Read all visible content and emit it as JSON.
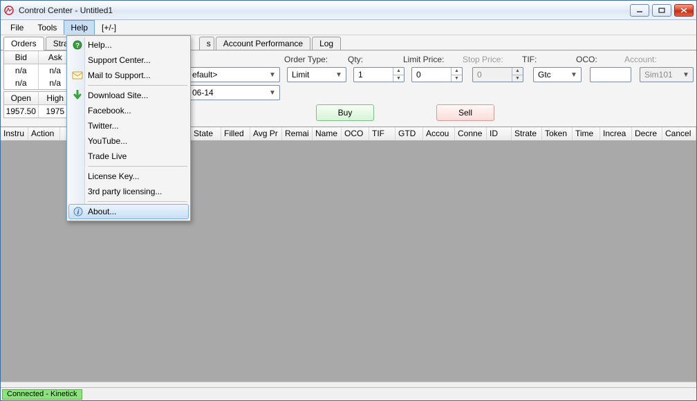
{
  "window": {
    "title": "Control Center - Untitled1"
  },
  "menubar": [
    "File",
    "Tools",
    "Help",
    "[+/-]"
  ],
  "tabs": [
    "Orders",
    "Strategies",
    "s",
    "Account Performance",
    "Log"
  ],
  "miniTables": {
    "prices": {
      "headers": [
        "Bid",
        "Ask"
      ],
      "rows": [
        [
          "n/a",
          "n/a"
        ],
        [
          "n/a",
          "n/a"
        ]
      ]
    },
    "ohlc": {
      "headers": [
        "Open",
        "High"
      ],
      "rows": [
        [
          "1957.50",
          "1975"
        ]
      ]
    }
  },
  "orderForm": {
    "labels": {
      "orderType": "Order Type:",
      "qty": "Qty:",
      "limitPrice": "Limit Price:",
      "stopPrice": "Stop Price:",
      "tif": "TIF:",
      "oco": "OCO:",
      "account": "Account:"
    },
    "combo1": "efault>",
    "combo2": "06-14",
    "orderTypeValue": "Limit",
    "qtyValue": "1",
    "limitPriceValue": "0",
    "stopPriceValue": "0",
    "tifValue": "Gtc",
    "ocoValue": "",
    "accountValue": "Sim101",
    "buy": "Buy",
    "sell": "Sell"
  },
  "gridColumns": [
    "Instru",
    "Action",
    "",
    "",
    "State",
    "Filled",
    "Avg Pr",
    "Remai",
    "Name",
    "OCO",
    "TIF",
    "GTD",
    "Accou",
    "Conne",
    "ID",
    "Strate",
    "Token",
    "Time",
    "Increa",
    "Decre",
    "Cancel"
  ],
  "helpMenu": {
    "items": [
      {
        "label": "Help...",
        "icon": "help"
      },
      {
        "label": "Support Center..."
      },
      {
        "label": "Mail to Support...",
        "icon": "mail"
      },
      {
        "sep": true
      },
      {
        "label": "Download Site...",
        "icon": "down"
      },
      {
        "label": "Facebook..."
      },
      {
        "label": "Twitter..."
      },
      {
        "label": "YouTube..."
      },
      {
        "label": "Trade Live"
      },
      {
        "sep": true
      },
      {
        "label": "License Key..."
      },
      {
        "label": "3rd party licensing..."
      },
      {
        "sep": true
      },
      {
        "label": "About...",
        "icon": "info",
        "highlight": true
      }
    ]
  },
  "status": "Connected - Kinetick"
}
